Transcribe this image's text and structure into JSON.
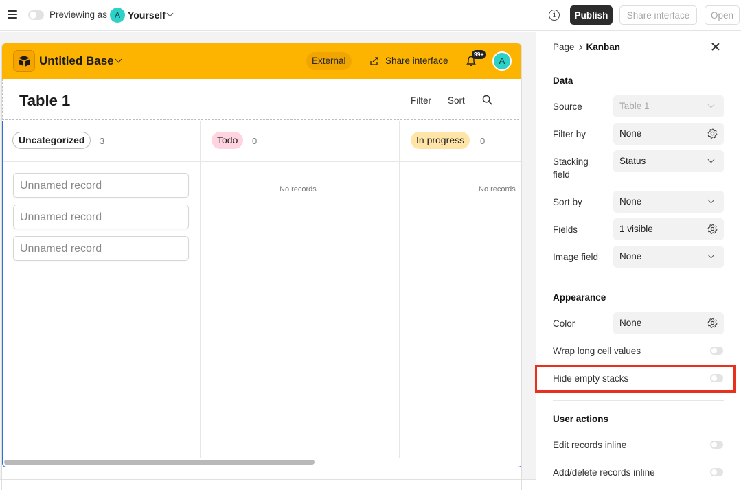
{
  "topbar": {
    "preview_label": "Previewing as",
    "avatar_initial": "A",
    "user_name": "Yourself",
    "info_glyph": "i",
    "publish_label": "Publish",
    "share_interface_label": "Share interface",
    "open_label": "Open"
  },
  "app": {
    "base_title": "Untitled Base",
    "external_label": "External",
    "share_interface_label": "Share interface",
    "notifications_badge": "99+",
    "avatar_initial": "A"
  },
  "table": {
    "title": "Table 1",
    "filter_label": "Filter",
    "sort_label": "Sort"
  },
  "kanban": {
    "columns": [
      {
        "label": "Uncategorized",
        "count": "3",
        "records": [
          "Unnamed record",
          "Unnamed record",
          "Unnamed record"
        ],
        "empty_text": ""
      },
      {
        "label": "Todo",
        "count": "0",
        "records": [],
        "empty_text": "No records"
      },
      {
        "label": "In progress",
        "count": "0",
        "records": [],
        "empty_text": "No records"
      }
    ]
  },
  "panel": {
    "breadcrumb_parent": "Page",
    "breadcrumb_current": "Kanban",
    "data_section": {
      "title": "Data",
      "source_label": "Source",
      "source_value": "Table 1",
      "filter_label": "Filter by",
      "filter_value": "None",
      "stacking_label": "Stacking field",
      "stacking_value": "Status",
      "sort_label": "Sort by",
      "sort_value": "None",
      "fields_label": "Fields",
      "fields_value": "1 visible",
      "image_label": "Image field",
      "image_value": "None"
    },
    "appearance_section": {
      "title": "Appearance",
      "color_label": "Color",
      "color_value": "None",
      "wrap_label": "Wrap long cell values",
      "hide_empty_label": "Hide empty stacks"
    },
    "user_actions_section": {
      "title": "User actions",
      "edit_inline_label": "Edit records inline",
      "add_delete_label": "Add/delete records inline"
    }
  },
  "colors": {
    "header_yellow": "#fcb400",
    "accent_blue": "#2f6fd8",
    "highlight_red": "#e8301c",
    "avatar_teal": "#2ed1c8"
  }
}
